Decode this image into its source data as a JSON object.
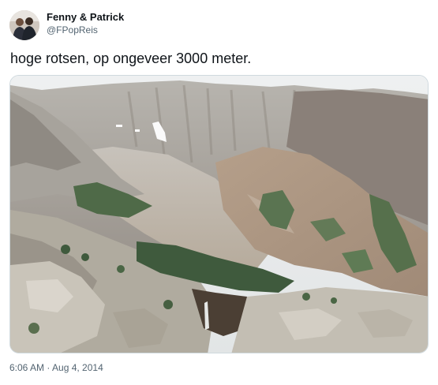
{
  "author": {
    "name": "Fenny & Patrick",
    "handle": "@FPopReis"
  },
  "tweet": {
    "text": "hoge rotsen, op ongeveer 3000 meter.",
    "timestamp": "6:06 AM · Aug 4, 2014"
  },
  "media": {
    "type": "photo",
    "subject": "rocky mountain slope"
  }
}
